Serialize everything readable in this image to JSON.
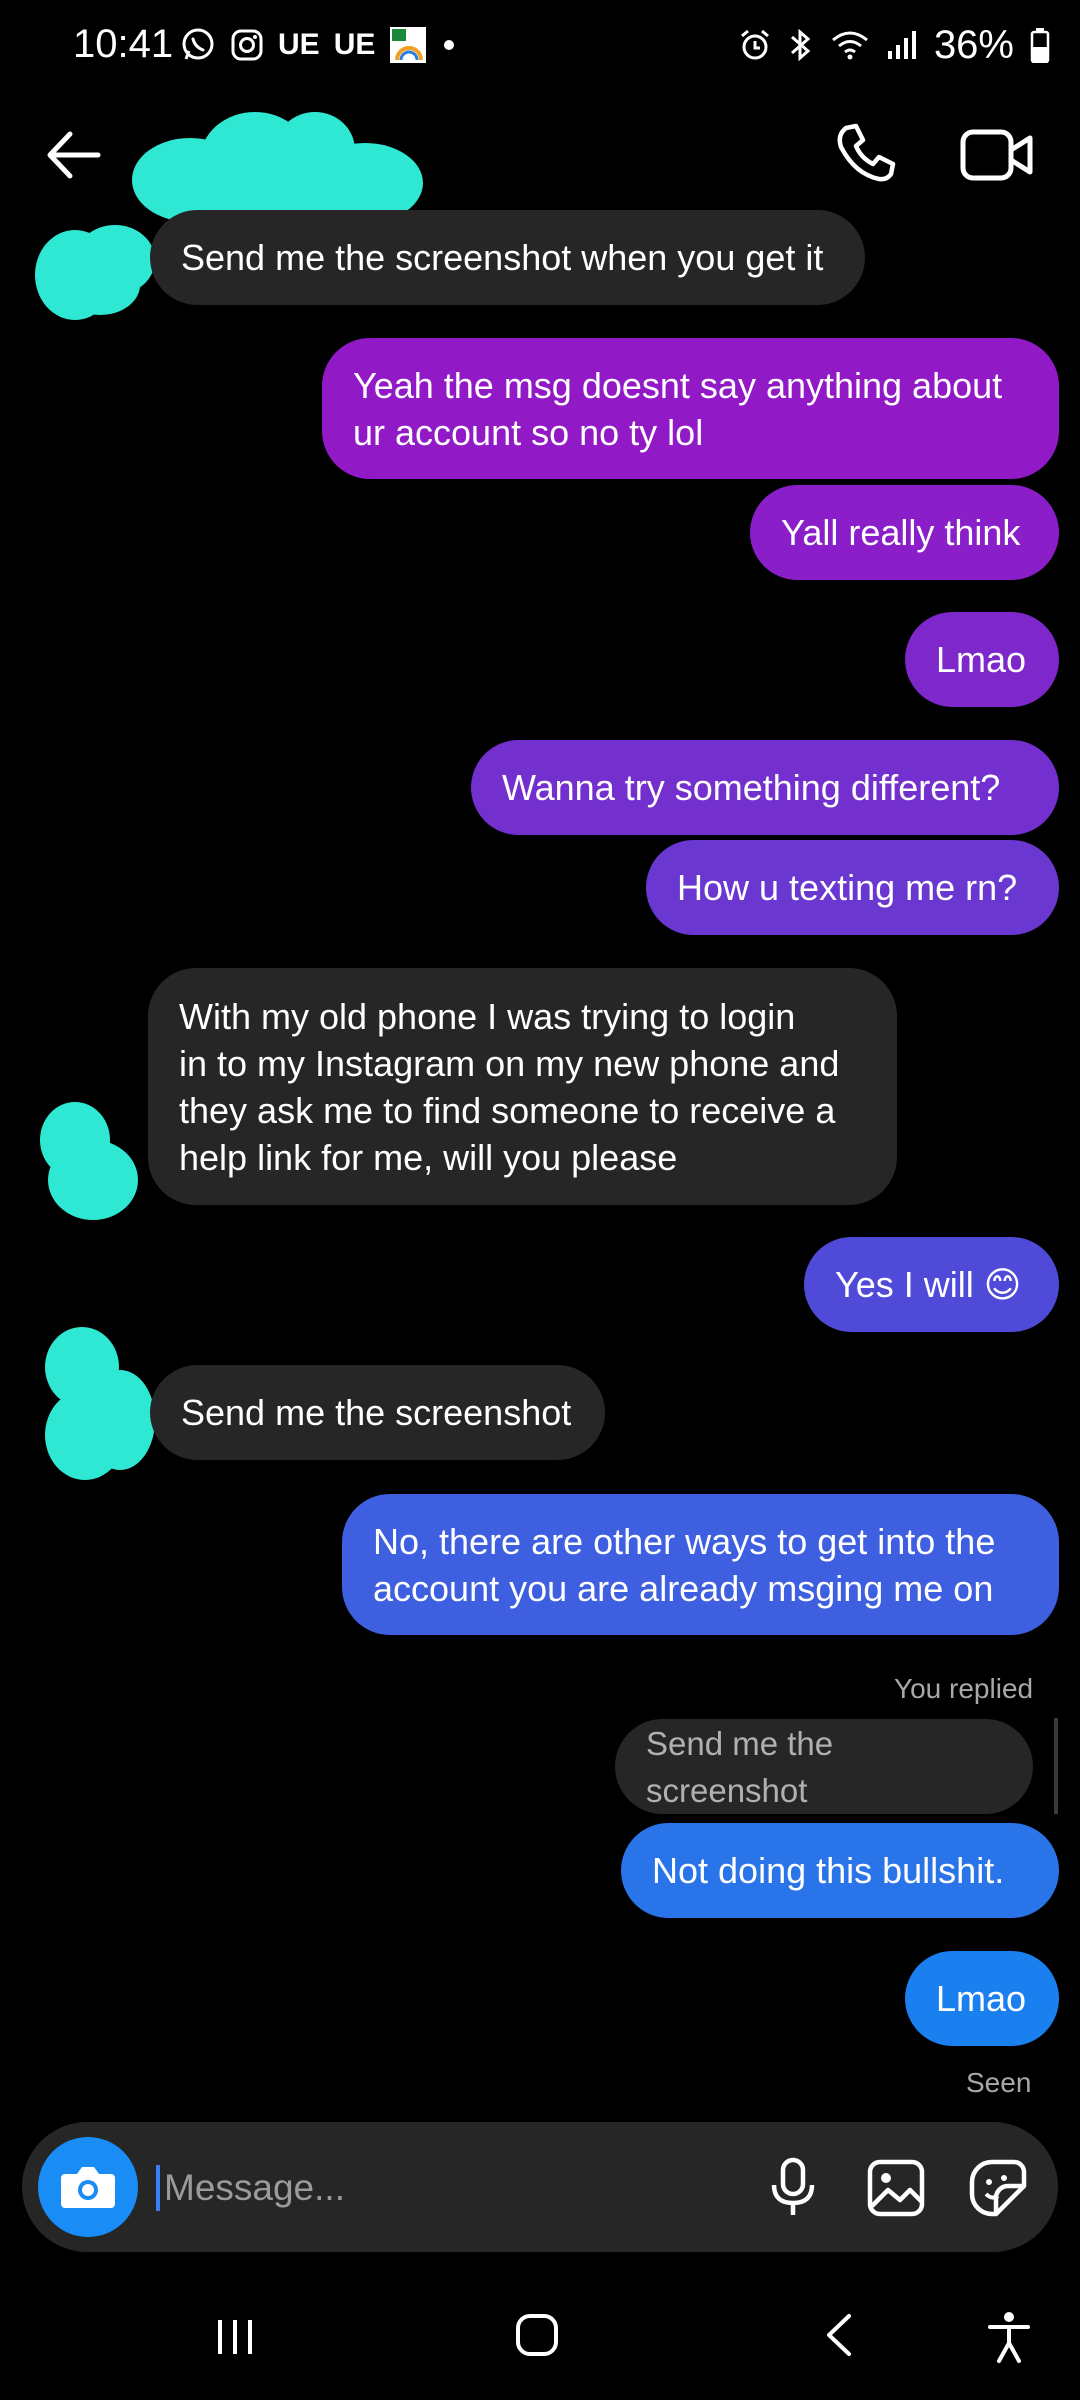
{
  "status_bar": {
    "time": "10:41",
    "app_icons": [
      "whatsapp-icon",
      "instagram-icon",
      "ue-label",
      "ue-label",
      "td-app-icon",
      "dot-icon"
    ],
    "ue_label_1": "UE",
    "ue_label_2": "UE",
    "right_icons": [
      "alarm-icon",
      "bluetooth-icon",
      "wifi-icon",
      "signal-icon",
      "battery-icon"
    ],
    "battery": "36%"
  },
  "header": {
    "back": "back-arrow-icon",
    "contact_name_redacted": true,
    "actions": [
      "phone-icon",
      "video-camera-icon"
    ]
  },
  "colors": {
    "background": "#000000",
    "incoming_bubble": "#262626",
    "redaction": "#2ee8d4",
    "gradient_top": "#9a19c7",
    "gradient_bottom": "#1a80ef"
  },
  "messages": [
    {
      "dir": "in",
      "text": "Send me the screenshot when you get it"
    },
    {
      "dir": "out",
      "text": "Yeah the msg doesnt say anything about\nur account so no ty lol"
    },
    {
      "dir": "out",
      "text": "Yall really think"
    },
    {
      "dir": "out",
      "text": "Lmao"
    },
    {
      "dir": "out",
      "text": "Wanna try something different?"
    },
    {
      "dir": "out",
      "text": "How u texting me rn?"
    },
    {
      "dir": "in",
      "text": "With my old phone I was trying to login\nin to my Instagram on my new phone and\nthey ask me to find someone to receive a\nhelp link for me, will you please"
    },
    {
      "dir": "out",
      "text": "Yes I will 😊"
    },
    {
      "dir": "in",
      "text": "Send me the screenshot"
    },
    {
      "dir": "out",
      "text": "No, there are other ways to get into the\naccount you are already msging me on"
    },
    {
      "dir": "reply_quote",
      "text": "Send me the screenshot"
    },
    {
      "dir": "out",
      "text": "Not doing this bullshit."
    },
    {
      "dir": "out",
      "text": "Lmao"
    }
  ],
  "reply_label": "You replied",
  "seen_label": "Seen",
  "composer": {
    "placeholder": "Message...",
    "icons": [
      "camera-icon",
      "microphone-icon",
      "gallery-icon",
      "sticker-icon"
    ]
  },
  "nav_bar": {
    "icons": [
      "recent-apps-icon",
      "home-icon",
      "back-icon",
      "accessibility-icon"
    ]
  }
}
